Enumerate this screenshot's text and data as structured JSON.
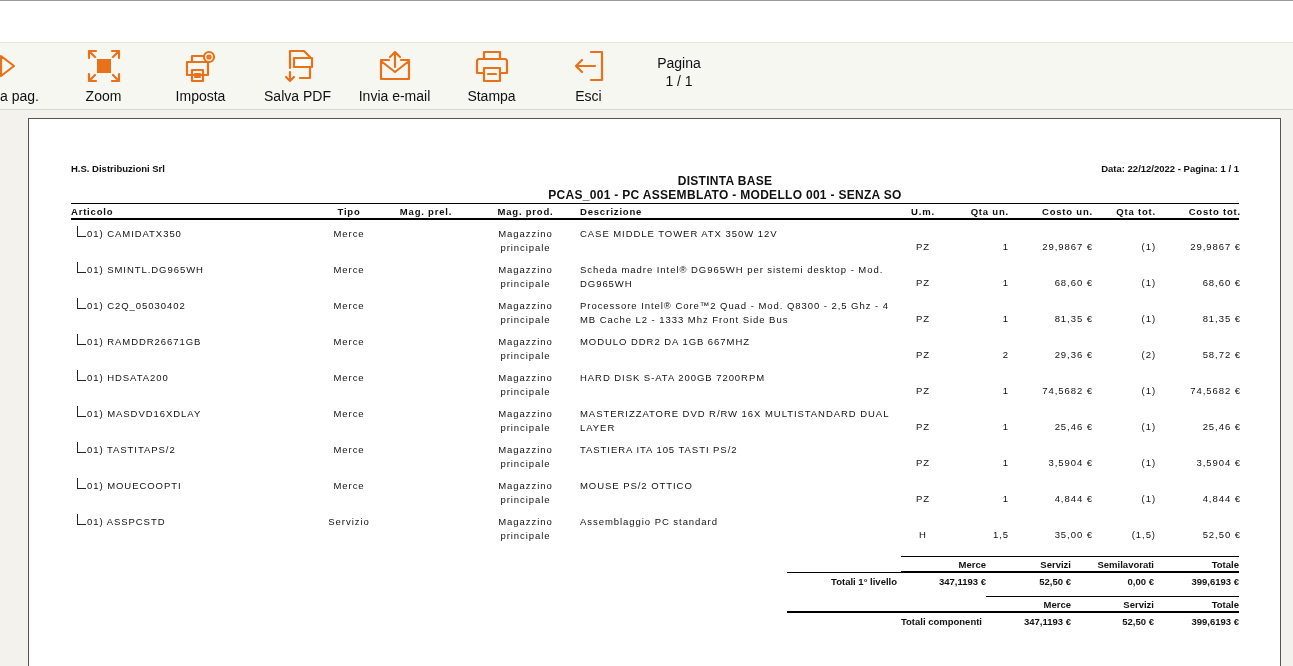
{
  "toolbar": {
    "buttons": [
      {
        "label": "a pag.",
        "kind": "next"
      },
      {
        "label": "Zoom",
        "kind": "zoom"
      },
      {
        "label": "Imposta",
        "kind": "setup"
      },
      {
        "label": "Salva PDF",
        "kind": "pdf"
      },
      {
        "label": "Invia e-mail",
        "kind": "mail"
      },
      {
        "label": "Stampa",
        "kind": "print"
      },
      {
        "label": "Esci",
        "kind": "exit"
      }
    ],
    "page_label": "Pagina",
    "page_value": "1 / 1"
  },
  "report": {
    "company": "H.S. Distribuzioni Srl",
    "date_page": "Data: 22/12/2022 - Pagina: 1 / 1",
    "title": "DISTINTA BASE",
    "subtitle": "PCAS_001 - PC ASSEMBLATO - MODELLO 001 - SENZA SO",
    "columns": [
      "Articolo",
      "Tipo",
      "Mag. prel.",
      "Mag. prod.",
      "Descrizione",
      "U.m.",
      "Qta un.",
      "Costo un.",
      "Qta tot.",
      "Costo tot."
    ],
    "rows": [
      {
        "articolo": "01) CAMIDATX350",
        "tipo": "Merce",
        "mag_prod": "Magazzino principale",
        "descrizione": "CASE MIDDLE TOWER ATX  350W 12V",
        "um": "PZ",
        "qta_un": "1",
        "costo_un": "29,9867 €",
        "qta_tot": "(1)",
        "costo_tot": "29,9867 €"
      },
      {
        "articolo": "01) SMINTL.DG965WH",
        "tipo": "Merce",
        "mag_prod": "Magazzino principale",
        "descrizione": "Scheda madre Intel® DG965WH per sistemi desktop - Mod. DG965WH",
        "um": "PZ",
        "qta_un": "1",
        "costo_un": "68,60 €",
        "qta_tot": "(1)",
        "costo_tot": "68,60 €"
      },
      {
        "articolo": "01) C2Q_05030402",
        "tipo": "Merce",
        "mag_prod": "Magazzino principale",
        "descrizione": "Processore Intel® Core™2 Quad - Mod. Q8300 - 2,5 Ghz - 4 MB Cache L2 - 1333 Mhz Front Side Bus",
        "um": "PZ",
        "qta_un": "1",
        "costo_un": "81,35 €",
        "qta_tot": "(1)",
        "costo_tot": "81,35 €"
      },
      {
        "articolo": "01) RAMDDR26671GB",
        "tipo": "Merce",
        "mag_prod": "Magazzino principale",
        "descrizione": "MODULO DDR2 DA 1GB 667MHZ",
        "um": "PZ",
        "qta_un": "2",
        "costo_un": "29,36 €",
        "qta_tot": "(2)",
        "costo_tot": "58,72 €"
      },
      {
        "articolo": "01) HDSATA200",
        "tipo": "Merce",
        "mag_prod": "Magazzino principale",
        "descrizione": "HARD DISK S-ATA 200GB 7200RPM",
        "um": "PZ",
        "qta_un": "1",
        "costo_un": "74,5682 €",
        "qta_tot": "(1)",
        "costo_tot": "74,5682 €"
      },
      {
        "articolo": "01) MASDVD16XDLAY",
        "tipo": "Merce",
        "mag_prod": "Magazzino principale",
        "descrizione": "MASTERIZZATORE DVD R/RW 16X MULTISTANDARD DUAL LAYER",
        "um": "PZ",
        "qta_un": "1",
        "costo_un": "25,46 €",
        "qta_tot": "(1)",
        "costo_tot": "25,46 €"
      },
      {
        "articolo": "01) TASTITAPS/2",
        "tipo": "Merce",
        "mag_prod": "Magazzino principale",
        "descrizione": "TASTIERA ITA 105 TASTI PS/2",
        "um": "PZ",
        "qta_un": "1",
        "costo_un": "3,5904 €",
        "qta_tot": "(1)",
        "costo_tot": "3,5904 €"
      },
      {
        "articolo": "01) MOUECOOPTI",
        "tipo": "Merce",
        "mag_prod": "Magazzino principale",
        "descrizione": "MOUSE PS/2 OTTICO",
        "um": "PZ",
        "qta_un": "1",
        "costo_un": "4,844 €",
        "qta_tot": "(1)",
        "costo_tot": "4,844 €"
      },
      {
        "articolo": "01) ASSPCSTD",
        "tipo": "Servizio",
        "mag_prod": "Magazzino principale",
        "descrizione": "Assemblaggio PC standard",
        "um": "H",
        "qta_un": "1,5",
        "costo_un": "35,00 €",
        "qta_tot": "(1,5)",
        "costo_tot": "52,50 €"
      }
    ],
    "totals_first_level": {
      "label": "Totali 1° livello",
      "columns": [
        "Merce",
        "Servizi",
        "Semilavorati",
        "Totale"
      ],
      "values": [
        "347,1193 €",
        "52,50 €",
        "0,00 €",
        "399,6193 €"
      ]
    },
    "totals_components": {
      "label": "Totali componenti",
      "columns": [
        "Merce",
        "Servizi",
        "Totale"
      ],
      "values": [
        "347,1193 €",
        "52,50 €",
        "399,6193 €"
      ]
    }
  }
}
